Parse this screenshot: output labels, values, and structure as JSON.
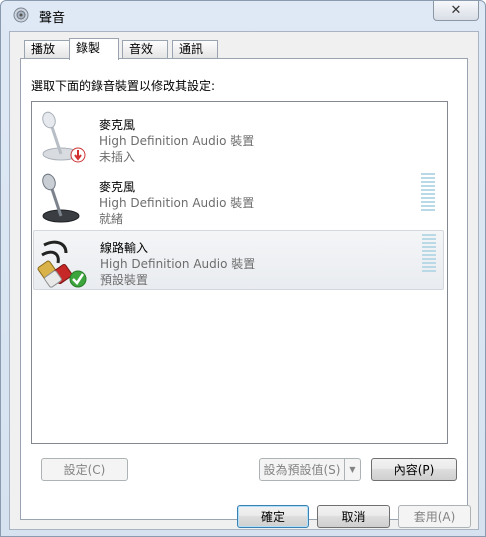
{
  "window": {
    "title": "聲音",
    "close_label": "✕"
  },
  "tabs": [
    {
      "label": "播放",
      "active": false
    },
    {
      "label": "錄製",
      "active": true
    },
    {
      "label": "音效",
      "active": false
    },
    {
      "label": "通訊",
      "active": false
    }
  ],
  "instruction": "選取下面的錄音裝置以修改其設定:",
  "devices": [
    {
      "name": "麥克風",
      "description": "High Definition Audio 裝置",
      "status": "未插入",
      "icon": "microphone-unplugged-icon",
      "selected": false
    },
    {
      "name": "麥克風",
      "description": "High Definition Audio 裝置",
      "status": "就緒",
      "icon": "microphone-icon",
      "selected": false
    },
    {
      "name": "線路輸入",
      "description": "High Definition Audio 裝置",
      "status": "預設裝置",
      "icon": "line-in-cable-icon",
      "selected": true,
      "default_badge": "check-icon"
    }
  ],
  "buttons": {
    "configure": "設定(C)",
    "set_default": "設為預設值(S)",
    "properties": "內容(P)",
    "ok": "確定",
    "cancel": "取消",
    "apply": "套用(A)"
  },
  "colors": {
    "accent": "#3c7fb1",
    "meter": "#b9d9e6",
    "default_check": "#3ca53c",
    "unplugged_badge": "#d32f2f"
  }
}
